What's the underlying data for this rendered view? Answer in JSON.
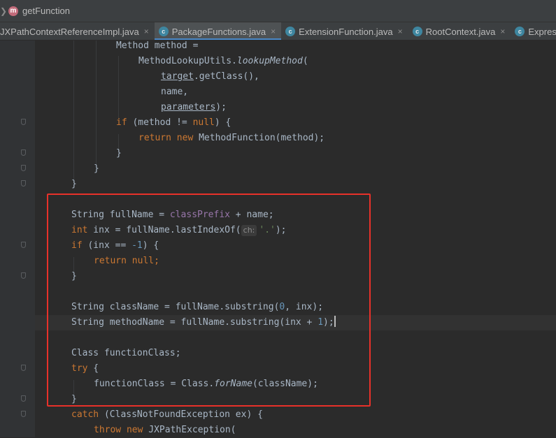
{
  "breadcrumb": {
    "method_badge": "m",
    "method_name": "getFunction"
  },
  "tabs": [
    {
      "label": "JXPathContextReferenceImpl.java",
      "icon": "none",
      "close": "×"
    },
    {
      "label": "PackageFunctions.java",
      "icon": "class-icon",
      "close": "×"
    },
    {
      "label": "ExtensionFunction.java",
      "icon": "class-icon",
      "close": "×"
    },
    {
      "label": "RootContext.java",
      "icon": "class-icon",
      "close": "×"
    },
    {
      "label": "Expressio",
      "icon": "class-icon",
      "close": ""
    }
  ],
  "tab_icon_letter": "c",
  "code": {
    "l1": {
      "t1": "Method",
      "t2": " method ="
    },
    "l2": {
      "t1": "MethodLookupUtils.",
      "t2": "lookupMethod",
      "t3": "("
    },
    "l3": {
      "t1": "target",
      "t2": ".getClass(),"
    },
    "l4": {
      "t1": "name,"
    },
    "l5": {
      "t1": "parameters",
      "t2": ");"
    },
    "l6": {
      "k1": "if",
      "t1": " (method != ",
      "k2": "null",
      "t2": ") {"
    },
    "l7": {
      "k1": "return",
      "k2": " new",
      "t1": " MethodFunction(method);"
    },
    "l8": {
      "t1": "}"
    },
    "l9": {
      "t1": "}"
    },
    "l10": {
      "t1": "}"
    },
    "l12": {
      "t1": "String fullName = ",
      "f1": "classPrefix",
      "t2": " + name;"
    },
    "l13": {
      "k1": "int",
      "t1": " inx = fullName.lastIndexOf(",
      "hint": "ch:",
      "s1": "'.'",
      "t2": ");"
    },
    "l14": {
      "k1": "if",
      "t1": " (inx == ",
      "n1": "-1",
      "t2": ") {"
    },
    "l15": {
      "k1": "return",
      "k2": " null",
      "t1": ";"
    },
    "l16": {
      "t1": "}"
    },
    "l18": {
      "t1": "String className = fullName.substring(",
      "n1": "0",
      "t2": ", inx);"
    },
    "l19": {
      "t1": "String methodName = fullName.substring(inx + ",
      "n1": "1",
      "t2": ");"
    },
    "l21": {
      "t1": "Class functionClass;"
    },
    "l22": {
      "k1": "try",
      "t1": " {"
    },
    "l23": {
      "t1": "functionClass = Class.",
      "i1": "forName",
      "t2": "(className);"
    },
    "l24": {
      "t1": "}"
    },
    "l25": {
      "k1": "catch",
      "t1": " (ClassNotFoundException ex) {"
    },
    "l26": {
      "k1": "throw",
      "k2": " new",
      "t1": " JXPathException("
    }
  },
  "colors": {
    "background": "#2b2b2b",
    "keyword": "#cc7832",
    "field": "#9876aa",
    "number": "#6897bb",
    "string": "#6a8759",
    "text": "#a9b7c6",
    "highlight_box": "#e8312a"
  }
}
